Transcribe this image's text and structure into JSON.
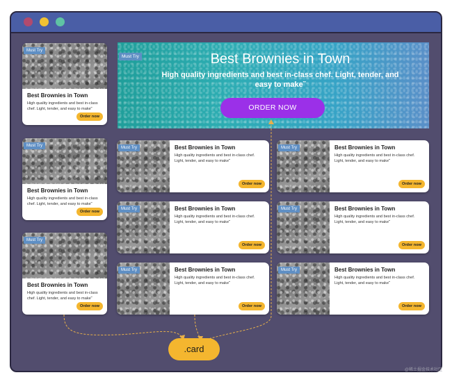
{
  "cards": {
    "tag": "Must Try",
    "title": "Best Brownies in Town",
    "description": "High quality ingredients and best in-class chef. Light, tender, and easy to make˜",
    "button": "Order now"
  },
  "hero": {
    "tag": "Must Try",
    "title": "Best Brownies in Town",
    "subtitle": "High quality ingredients and best in-class chef. Light, tender, and easy to make˜",
    "button": "ORDER NOW"
  },
  "annotation_label": ".card",
  "watermark": "@稀土掘金技术社区",
  "colors": {
    "window_bg": "#524d6e",
    "titlebar": "#4a5ea6",
    "accent_yellow": "#f4b62f",
    "hero_button": "#9b30e8",
    "tag_blue": "#5f8fc4"
  }
}
